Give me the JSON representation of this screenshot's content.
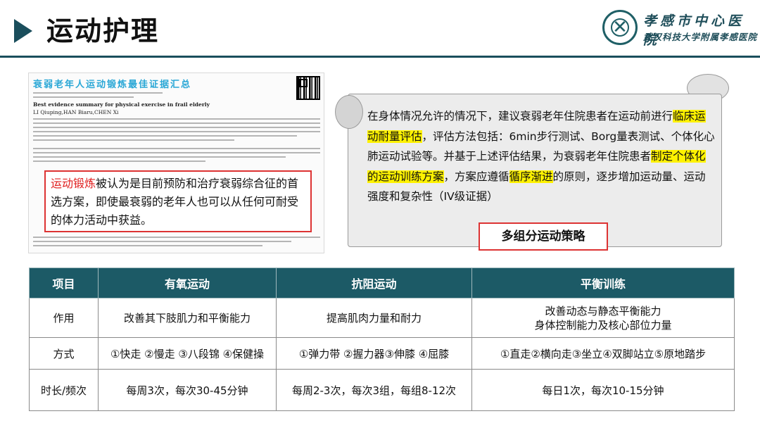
{
  "header": {
    "title": "运动护理",
    "hospital_name": "孝感市中心医院",
    "hospital_subtitle": "武汉科技大学附属孝感医院"
  },
  "paper": {
    "title": "衰弱老年人运动锻炼最佳证据汇总",
    "english_title": "Best evidence summary for physical exercise in frail elderly",
    "english_authors": "LI Qiuping,HAN Biaru,CHEN Xi",
    "callout_highlight": "运动锻炼",
    "callout_text": "被认为是目前预防和治疗衰弱综合征的首选方案，即使最衰弱的老年人也可以从任何可耐受的体力活动中获益。"
  },
  "scroll": {
    "parts": [
      {
        "text": "在身体情况允许的情况下，建议衰弱老年住院患者在运动前进行",
        "hl": false
      },
      {
        "text": "临床运动耐量评估",
        "hl": true
      },
      {
        "text": "，评估方法包括：6min步行测试、Borg量表测试、个体化心肺运动试验等。并基于上述评估结果，为衰弱老年住院患者",
        "hl": false
      },
      {
        "text": "制定个体化的运动训练方案",
        "hl": true
      },
      {
        "text": "，方案应遵循",
        "hl": false
      },
      {
        "text": "循序渐进",
        "hl": true
      },
      {
        "text": "的原则，逐步增加运动量、运动强度和复杂性（IV级证据）",
        "hl": false
      }
    ],
    "label": "多组分运动策略"
  },
  "table": {
    "headers": [
      "项目",
      "有氧运动",
      "抗阻运动",
      "平衡训练"
    ],
    "rows": [
      {
        "label": "作用",
        "cells": [
          "改善其下肢肌力和平衡能力",
          "提高肌肉力量和耐力",
          "改善动态与静态平衡能力\n身体控制能力及核心部位力量"
        ]
      },
      {
        "label": "方式",
        "cells": [
          "①快走 ②慢走 ③八段锦 ④保健操",
          "①弹力带 ②握力器③伸膝 ④屈膝",
          "①直走②横向走③坐立④双脚站立⑤原地踏步"
        ]
      },
      {
        "label": "时长/频次",
        "cells": [
          "每周3次，每次30-45分钟",
          "每周2-3次，每次3组，每组8-12次",
          "每日1次，每次10-15分钟"
        ]
      }
    ]
  },
  "colors": {
    "primary": "#1c5a66",
    "highlight": "#fff200",
    "accent_red": "#e02020"
  }
}
